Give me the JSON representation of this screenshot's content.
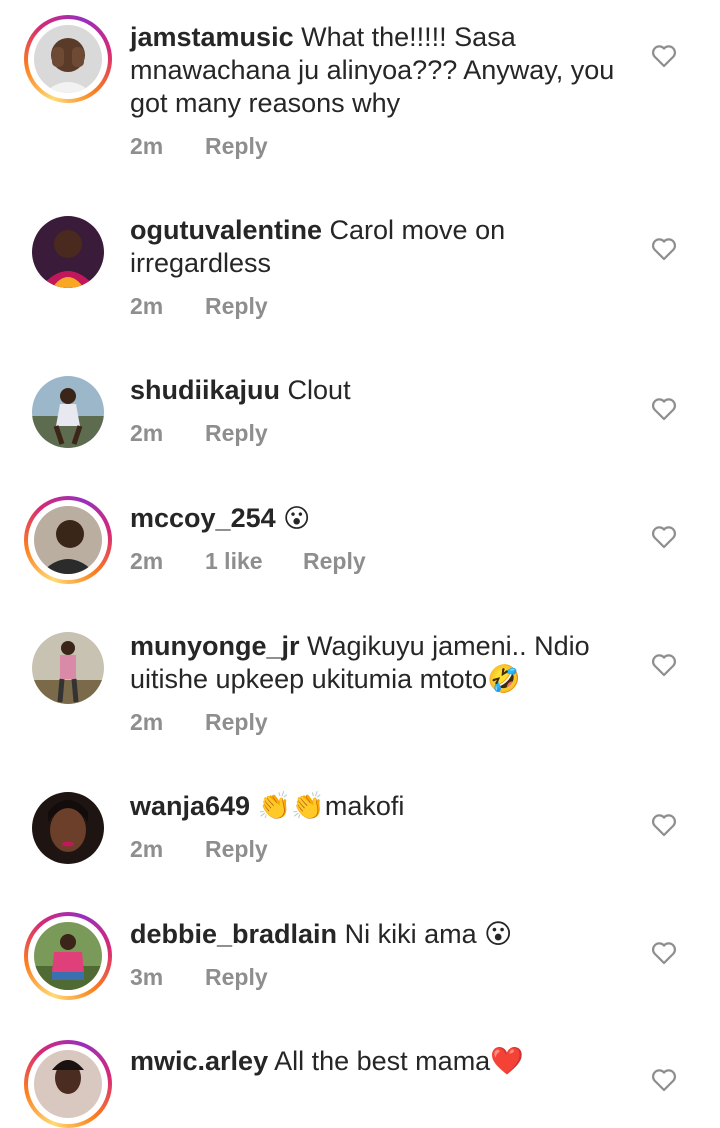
{
  "comments": [
    {
      "username": "jamstamusic",
      "text": "What the!!!!! Sasa mnawachana ju alinyoa??? Anyway, you got many reasons why",
      "time": "2m",
      "likes": "",
      "reply": "Reply",
      "story_ring": true,
      "avatar_icon": "hands-over-face-avatar"
    },
    {
      "username": "ogutuvalentine",
      "text": "Carol move on irregardless",
      "time": "2m",
      "likes": "",
      "reply": "Reply",
      "story_ring": false,
      "avatar_icon": "woman-colorful-avatar"
    },
    {
      "username": "shudiikajuu",
      "text": "Clout",
      "time": "2m",
      "likes": "",
      "reply": "Reply",
      "story_ring": false,
      "avatar_icon": "outdoor-pose-avatar"
    },
    {
      "username": "mccoy_254",
      "text": "😮",
      "time": "2m",
      "likes": "1 like",
      "reply": "Reply",
      "story_ring": true,
      "avatar_icon": "man-portrait-avatar"
    },
    {
      "username": "munyonge_jr",
      "text": "Wagikuyu jameni.. Ndio uitishe upkeep ukitumia mtoto🤣",
      "time": "2m",
      "likes": "",
      "reply": "Reply",
      "story_ring": false,
      "avatar_icon": "standing-outdoor-avatar"
    },
    {
      "username": "wanja649",
      "text": "👏👏makofi",
      "time": "2m",
      "likes": "",
      "reply": "Reply",
      "story_ring": false,
      "avatar_icon": "woman-selfie-avatar"
    },
    {
      "username": "debbie_bradlain",
      "text": "Ni kiki ama 😮",
      "time": "3m",
      "likes": "",
      "reply": "Reply",
      "story_ring": true,
      "avatar_icon": "seated-garden-avatar"
    },
    {
      "username": "mwic.arley",
      "text": "All the best mama❤️",
      "time": "",
      "likes": "",
      "reply": "",
      "story_ring": true,
      "avatar_icon": "woman-portrait-avatar"
    }
  ],
  "colors": {
    "username": "#262626",
    "meta": "#8e8e8e",
    "heart_outline": "#8e8e8e"
  }
}
